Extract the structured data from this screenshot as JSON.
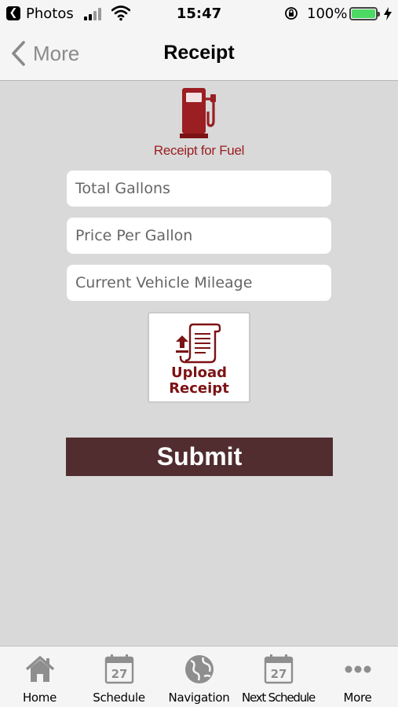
{
  "status_bar": {
    "back_app": "Photos",
    "time": "15:47",
    "battery_percent": "100%",
    "battery_level": 1.0,
    "battery_color": "#4cd964"
  },
  "nav": {
    "back_label": "More",
    "title": "Receipt"
  },
  "header": {
    "icon": "fuel-pump-icon",
    "caption": "Receipt for Fuel",
    "accent_color": "#9b1e23"
  },
  "form": {
    "total_gallons": {
      "placeholder": "Total Gallons",
      "value": ""
    },
    "price_per_gallon": {
      "placeholder": "Price Per Gallon",
      "value": ""
    },
    "vehicle_mileage": {
      "placeholder": "Current Vehicle Mileage",
      "value": ""
    },
    "upload": {
      "line1": "Upload",
      "line2": "Receipt",
      "icon": "upload-receipt-icon"
    },
    "submit_label": "Submit",
    "submit_color": "#512d30"
  },
  "tabs": [
    {
      "label": "Home",
      "icon": "home-icon"
    },
    {
      "label": "Schedule",
      "icon": "calendar-icon",
      "day": "27"
    },
    {
      "label": "Navigation",
      "icon": "globe-icon"
    },
    {
      "label": "Next Schedule",
      "icon": "calendar-icon",
      "day": "27"
    },
    {
      "label": "More",
      "icon": "more-dots-icon"
    }
  ]
}
